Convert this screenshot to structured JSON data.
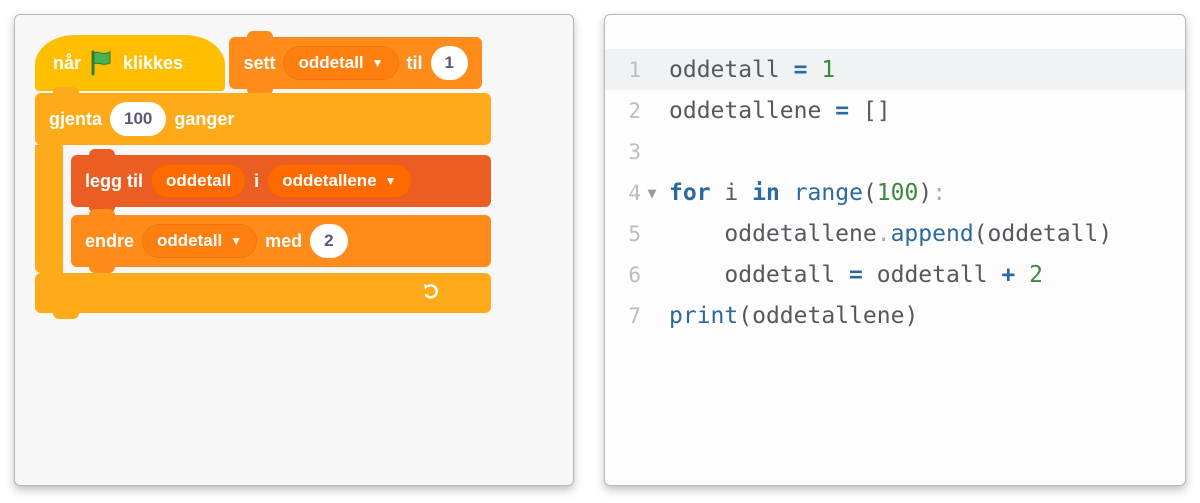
{
  "scratch": {
    "hat": {
      "prefix": "når",
      "suffix": "klikkes",
      "icon": "flag-icon"
    },
    "set": {
      "kw_set": "sett",
      "var": "oddetall",
      "kw_to": "til",
      "value": "1"
    },
    "repeat": {
      "kw": "gjenta",
      "count": "100",
      "kw_times": "ganger"
    },
    "add": {
      "kw_add": "legg til",
      "var": "oddetall",
      "kw_in": "i",
      "list": "oddetallene"
    },
    "change": {
      "kw": "endre",
      "var": "oddetall",
      "kw_by": "med",
      "value": "2"
    }
  },
  "code": {
    "lines": [
      {
        "n": "1",
        "fold": "",
        "active": true,
        "tokens": [
          [
            "name",
            "oddetall"
          ],
          [
            "sp",
            " "
          ],
          [
            "op",
            "="
          ],
          [
            "sp",
            " "
          ],
          [
            "num",
            "1"
          ]
        ]
      },
      {
        "n": "2",
        "fold": "",
        "active": false,
        "tokens": [
          [
            "name",
            "oddetallene"
          ],
          [
            "sp",
            " "
          ],
          [
            "op",
            "="
          ],
          [
            "sp",
            " "
          ],
          [
            "punc",
            "["
          ],
          [
            "punc",
            "]"
          ]
        ]
      },
      {
        "n": "3",
        "fold": "",
        "active": false,
        "tokens": []
      },
      {
        "n": "4",
        "fold": "▼",
        "active": false,
        "tokens": [
          [
            "kw",
            "for"
          ],
          [
            "sp",
            " "
          ],
          [
            "name",
            "i"
          ],
          [
            "sp",
            " "
          ],
          [
            "kw",
            "in"
          ],
          [
            "sp",
            " "
          ],
          [
            "fn",
            "range"
          ],
          [
            "punc",
            "("
          ],
          [
            "num",
            "100"
          ],
          [
            "punc",
            ")"
          ],
          [
            "pale",
            ":"
          ]
        ]
      },
      {
        "n": "5",
        "fold": "",
        "active": false,
        "tokens": [
          [
            "sp",
            "    "
          ],
          [
            "name",
            "oddetallene"
          ],
          [
            "pale",
            "."
          ],
          [
            "attr",
            "append"
          ],
          [
            "punc",
            "("
          ],
          [
            "name",
            "oddetall"
          ],
          [
            "punc",
            ")"
          ]
        ]
      },
      {
        "n": "6",
        "fold": "",
        "active": false,
        "tokens": [
          [
            "sp",
            "    "
          ],
          [
            "name",
            "oddetall"
          ],
          [
            "sp",
            " "
          ],
          [
            "op",
            "="
          ],
          [
            "sp",
            " "
          ],
          [
            "name",
            "oddetall"
          ],
          [
            "sp",
            " "
          ],
          [
            "op",
            "+"
          ],
          [
            "sp",
            " "
          ],
          [
            "num",
            "2"
          ]
        ]
      },
      {
        "n": "7",
        "fold": "",
        "active": false,
        "tokens": [
          [
            "fn",
            "print"
          ],
          [
            "punc",
            "("
          ],
          [
            "name",
            "oddetallene"
          ],
          [
            "punc",
            ")"
          ]
        ]
      }
    ]
  }
}
